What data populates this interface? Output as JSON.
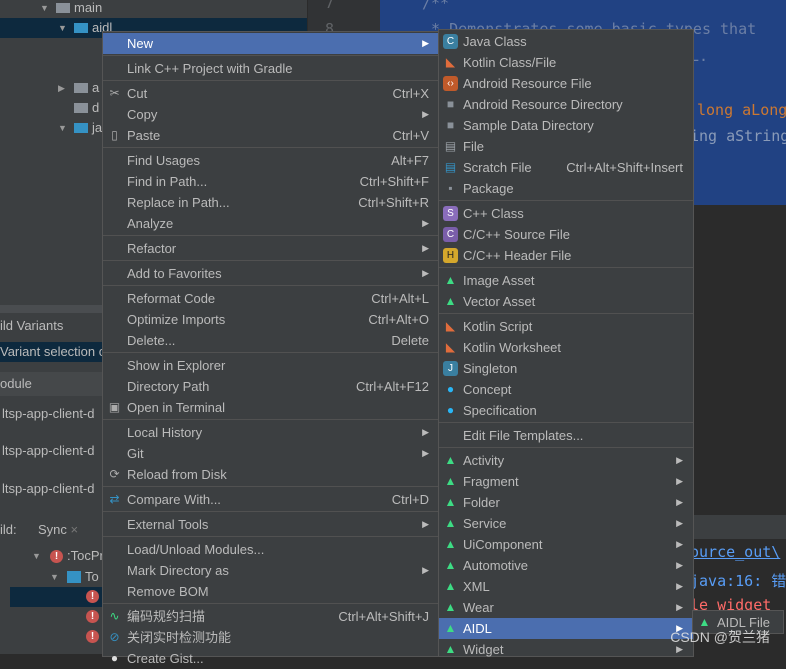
{
  "project_tree": {
    "main": "main",
    "aidl": "aidl",
    "assets": "a",
    "d": "d",
    "java": "ja"
  },
  "build_variants": {
    "title": "ild Variants",
    "selection": "Variant selection c",
    "header": "odule",
    "modules": [
      "ltsp-app-client-d",
      "ltsp-app-client-d",
      "ltsp-app-client-d"
    ]
  },
  "build_panel": {
    "label": "ild:",
    "tab": "Sync",
    "close": "×",
    "items": [
      ":TocPr",
      "To"
    ]
  },
  "editor": {
    "lines": [
      "7",
      "8"
    ],
    "code": [
      "/**",
      " * Demonstrates some basic types that",
      "L.",
      "long aLong",
      "ing aString"
    ]
  },
  "console": [
    "ource_out\\",
    "java:16: 错",
    "le widget"
  ],
  "context_menu": [
    {
      "label": "New",
      "arrow": true,
      "hl": true
    },
    {
      "sep": true
    },
    {
      "label": "Link C++ Project with Gradle"
    },
    {
      "sep": true
    },
    {
      "label": "Cut",
      "shortcut": "Ctrl+X",
      "icon": "scissors-icon"
    },
    {
      "label": "Copy",
      "arrow": true
    },
    {
      "label": "Paste",
      "shortcut": "Ctrl+V",
      "icon": "clipboard-icon"
    },
    {
      "sep": true
    },
    {
      "label": "Find Usages",
      "shortcut": "Alt+F7"
    },
    {
      "label": "Find in Path...",
      "shortcut": "Ctrl+Shift+F"
    },
    {
      "label": "Replace in Path...",
      "shortcut": "Ctrl+Shift+R"
    },
    {
      "label": "Analyze",
      "arrow": true
    },
    {
      "sep": true
    },
    {
      "label": "Refactor",
      "arrow": true
    },
    {
      "sep": true
    },
    {
      "label": "Add to Favorites",
      "arrow": true
    },
    {
      "sep": true
    },
    {
      "label": "Reformat Code",
      "shortcut": "Ctrl+Alt+L"
    },
    {
      "label": "Optimize Imports",
      "shortcut": "Ctrl+Alt+O"
    },
    {
      "label": "Delete...",
      "shortcut": "Delete"
    },
    {
      "sep": true
    },
    {
      "label": "Show in Explorer"
    },
    {
      "label": "Directory Path",
      "shortcut": "Ctrl+Alt+F12"
    },
    {
      "label": "Open in Terminal",
      "icon": "terminal-icon"
    },
    {
      "sep": true
    },
    {
      "label": "Local History",
      "arrow": true
    },
    {
      "label": "Git",
      "arrow": true
    },
    {
      "label": "Reload from Disk",
      "icon": "reload-icon"
    },
    {
      "sep": true
    },
    {
      "label": "Compare With...",
      "shortcut": "Ctrl+D",
      "icon": "compare-icon"
    },
    {
      "sep": true
    },
    {
      "label": "External Tools",
      "arrow": true
    },
    {
      "sep": true
    },
    {
      "label": "Load/Unload Modules..."
    },
    {
      "label": "Mark Directory as",
      "arrow": true
    },
    {
      "label": "Remove BOM"
    },
    {
      "sep": true
    },
    {
      "label": "编码规约扫描",
      "shortcut": "Ctrl+Alt+Shift+J",
      "icon": "scan-icon"
    },
    {
      "label": "关闭实时检测功能",
      "icon": "disable-icon"
    },
    {
      "label": "Create Gist...",
      "icon": "github-icon"
    }
  ],
  "new_submenu": [
    {
      "label": "Java Class",
      "icon": "java-class-icon"
    },
    {
      "label": "Kotlin Class/File",
      "icon": "kotlin-file-icon"
    },
    {
      "label": "Android Resource File",
      "icon": "resource-file-icon"
    },
    {
      "label": "Android Resource Directory",
      "icon": "folder-icon"
    },
    {
      "label": "Sample Data Directory",
      "icon": "folder-icon"
    },
    {
      "label": "File",
      "icon": "file-icon"
    },
    {
      "label": "Scratch File",
      "shortcut": "Ctrl+Alt+Shift+Insert",
      "icon": "scratch-file-icon"
    },
    {
      "label": "Package",
      "icon": "package-icon"
    },
    {
      "sep": true
    },
    {
      "label": "C++ Class",
      "icon": "cpp-class-icon"
    },
    {
      "label": "C/C++ Source File",
      "icon": "cpp-source-icon"
    },
    {
      "label": "C/C++ Header File",
      "icon": "cpp-header-icon"
    },
    {
      "sep": true
    },
    {
      "label": "Image Asset",
      "icon": "android-icon"
    },
    {
      "label": "Vector Asset",
      "icon": "android-icon"
    },
    {
      "sep": true
    },
    {
      "label": "Kotlin Script",
      "icon": "kotlin-file-icon"
    },
    {
      "label": "Kotlin Worksheet",
      "icon": "kotlin-file-icon"
    },
    {
      "label": "Singleton",
      "icon": "singleton-icon"
    },
    {
      "label": "Concept",
      "icon": "concept-icon"
    },
    {
      "label": "Specification",
      "icon": "concept-icon"
    },
    {
      "sep": true
    },
    {
      "label": "Edit File Templates..."
    },
    {
      "sep": true
    },
    {
      "label": "Activity",
      "arrow": true,
      "icon": "android-icon"
    },
    {
      "label": "Fragment",
      "arrow": true,
      "icon": "android-icon"
    },
    {
      "label": "Folder",
      "arrow": true,
      "icon": "android-icon"
    },
    {
      "label": "Service",
      "arrow": true,
      "icon": "android-icon"
    },
    {
      "label": "UiComponent",
      "arrow": true,
      "icon": "android-icon"
    },
    {
      "label": "Automotive",
      "arrow": true,
      "icon": "android-icon"
    },
    {
      "label": "XML",
      "arrow": true,
      "icon": "android-icon"
    },
    {
      "label": "Wear",
      "arrow": true,
      "icon": "android-icon"
    },
    {
      "label": "AIDL",
      "arrow": true,
      "icon": "android-icon",
      "hl": true
    },
    {
      "label": "Widget",
      "arrow": true,
      "icon": "android-icon"
    }
  ],
  "aidl_submenu": [
    {
      "label": "AIDL File",
      "icon": "aidl-file-icon"
    }
  ],
  "watermark": "CSDN @贺兰猪",
  "colors": {
    "highlight": "#4b6eaf",
    "menu_bg": "#3c3f41",
    "selection": "#214283",
    "android": "#3ddc84",
    "error": "#c75450"
  }
}
